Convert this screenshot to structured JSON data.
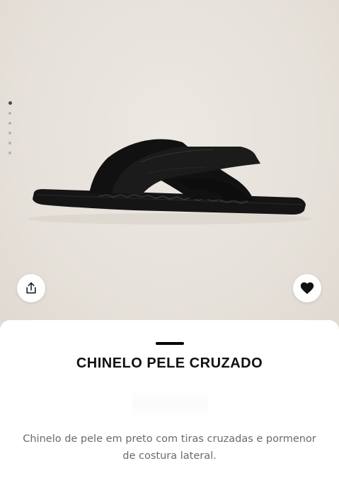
{
  "gallery": {
    "dot_count": 6,
    "active_index": 0,
    "image_alt": "sandal-product-image"
  },
  "actions": {
    "share_icon": "share-icon",
    "favorite_icon": "heart-icon"
  },
  "product": {
    "name": "CHINELO PELE CRUZADO",
    "description": "Chinelo de pele em preto com tiras cruzadas e pormenor de costura lateral."
  },
  "colors": {
    "background": "#e8e3dc",
    "sheet": "#ffffff",
    "title": "#111111",
    "description": "#6b6b6b",
    "product": "#151515"
  }
}
